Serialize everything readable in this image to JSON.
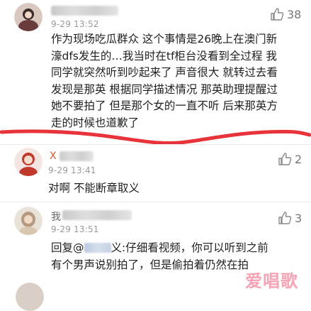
{
  "comments": [
    {
      "time": "9-29 13:52",
      "likes": "38",
      "lines": [
        "作为现场吃瓜群众 这个事情是26晚上在澳门新",
        "濠dfs发生的…我当时在tf柜台没看到全过程 我",
        "同学就突然听到吵起来了 声音很大 就转过去看",
        "发现是那英 根据同学描述情况 那英助理提醒过",
        "她不要拍了 但是那个女的一直不听 后来那英方",
        "走的时候也道歉了"
      ]
    },
    {
      "name_visible": "X",
      "time": "9-29 13:41",
      "likes": "2",
      "lines": [
        "对啊 不能断章取义"
      ]
    },
    {
      "name_visible": "我",
      "time": "9-29 13:51",
      "likes": "3",
      "reply_prefix": "回复@",
      "reply_after": "义:仔细看视频，你可以听到之前",
      "line2": "有个男声说别拍了，但是偷拍着仍然在拍"
    }
  ],
  "watermark": "爱唱歌",
  "colors": {
    "red_underline": "#e8333a",
    "time_gray": "#9a9a9a",
    "mention_blue": "#5a7fb5"
  },
  "icons": {
    "like": "thumbs-up-icon"
  }
}
